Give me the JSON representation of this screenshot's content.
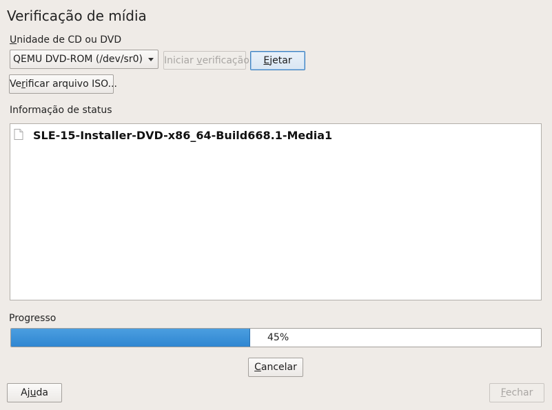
{
  "dialog": {
    "title": "Verificação de mídia"
  },
  "drive": {
    "label_prefix": "",
    "label_mnemonic": "U",
    "label_rest": "nidade de CD ou DVD",
    "selected_value": "QEMU DVD-ROM (/dev/sr0)"
  },
  "buttons": {
    "start_check": {
      "pre": "Iniciar ",
      "mn": "v",
      "post": "erificação",
      "disabled": true
    },
    "eject": {
      "pre": "",
      "mn": "E",
      "post": "jetar",
      "focused": true
    },
    "verify_iso": {
      "pre": "Ve",
      "mn": "r",
      "post": "ificar arquivo ISO..."
    },
    "cancel": {
      "pre": "",
      "mn": "C",
      "post": "ancelar"
    },
    "help": {
      "pre": "Aj",
      "mn": "u",
      "post": "da"
    },
    "close": {
      "pre": "",
      "mn": "F",
      "post": "echar",
      "disabled": true
    }
  },
  "status": {
    "label": "Informação de status",
    "items": [
      {
        "icon": "document-icon",
        "text": "SLE-15-Installer-DVD-x86_64-Build668.1-Media1"
      }
    ]
  },
  "progress": {
    "label": "Progresso",
    "value": 45,
    "text": "45%",
    "fill_color": "#3a8fd8"
  }
}
